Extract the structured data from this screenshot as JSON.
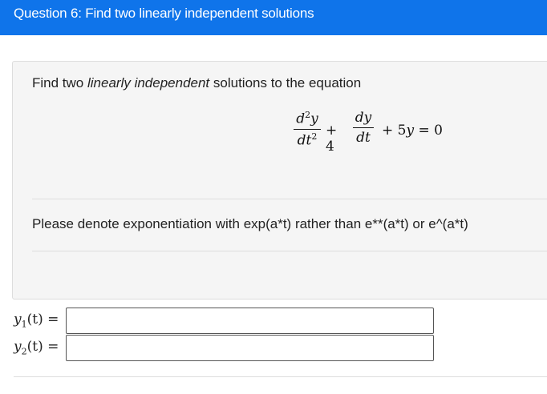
{
  "header": {
    "title": "Question 6: Find two linearly independent solutions"
  },
  "question": {
    "prompt_prefix": "Find two ",
    "prompt_emphasis": "linearly independent",
    "prompt_suffix": " solutions to the equation",
    "equation": {
      "d2y_num_d": "d",
      "d2y_num_exp": "2",
      "d2y_num_var": "y",
      "d2y_den_d": "dt",
      "d2y_den_exp": "2",
      "plus_four": "+ 4",
      "dy_num": "dy",
      "dy_den": "dt",
      "plus_5y": "+ 5",
      "y_var": "y",
      "equals_zero": " = 0"
    },
    "note": "Please denote exponentiation with exp(a*t) rather than e**(a*t) or e^(a*t)"
  },
  "answers": [
    {
      "fn": "y",
      "sub": "1",
      "arg": "(t) =",
      "value": "",
      "placeholder": ""
    },
    {
      "fn": "y",
      "sub": "2",
      "arg": "(t) =",
      "value": "",
      "placeholder": ""
    }
  ],
  "colors": {
    "header_bg": "#0f74ea",
    "panel_bg": "#f5f5f5"
  }
}
